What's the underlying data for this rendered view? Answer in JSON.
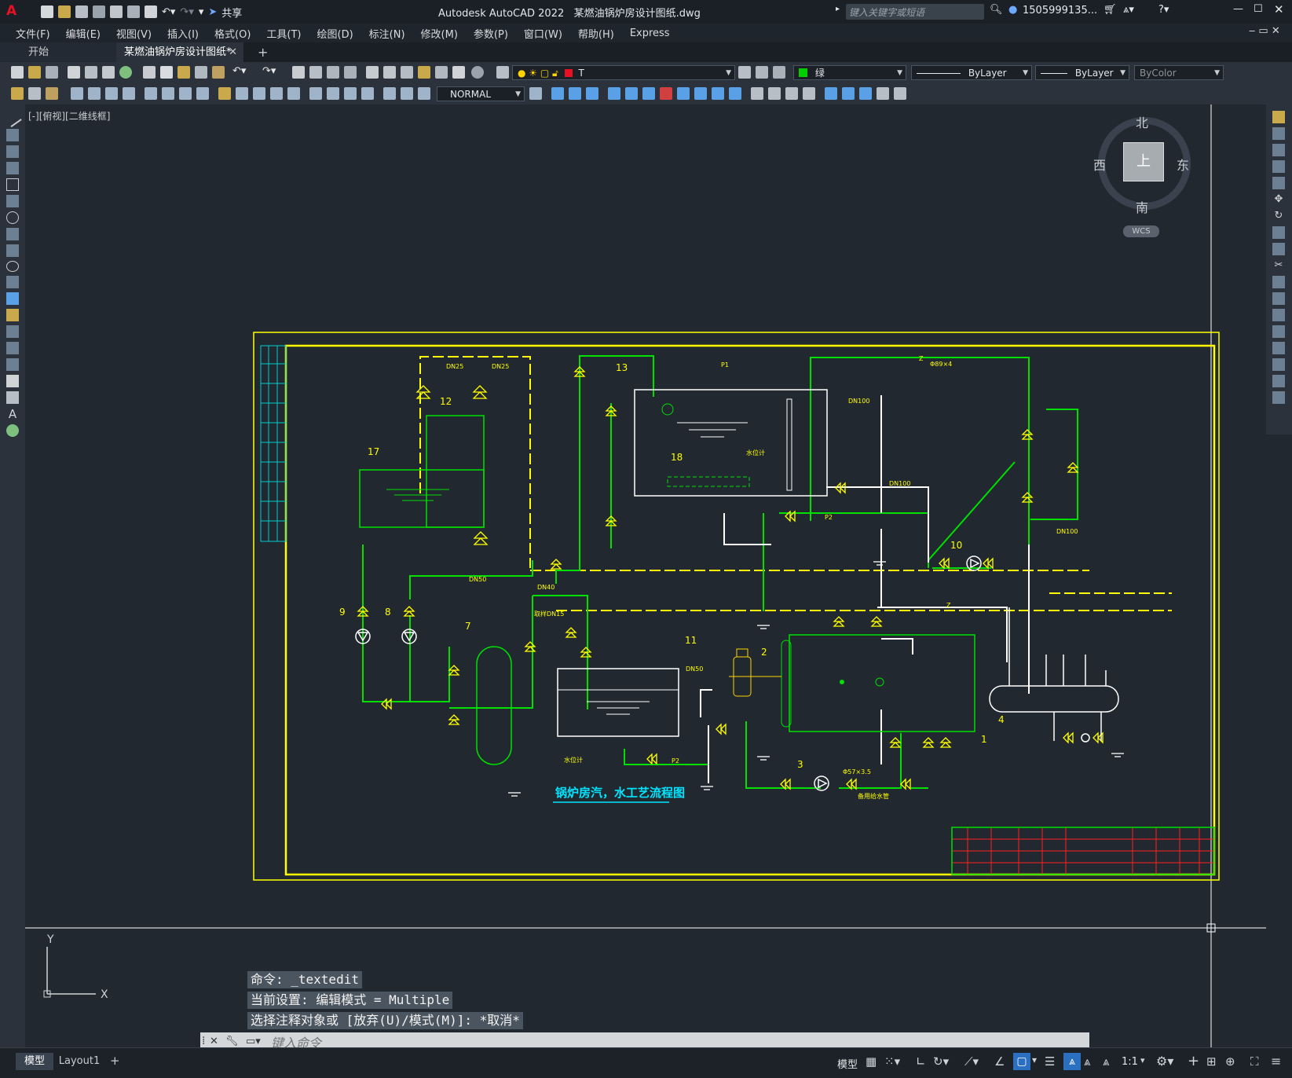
{
  "app": {
    "title": "Autodesk AutoCAD 2022",
    "file_name": "某燃油锅炉房设计图纸.dwg",
    "share_label": "共享",
    "search_placeholder": "键入关键字或短语",
    "user": "1505999135...",
    "app_letter": "A"
  },
  "menu": {
    "items": [
      "文件(F)",
      "编辑(E)",
      "视图(V)",
      "插入(I)",
      "格式(O)",
      "工具(T)",
      "绘图(D)",
      "标注(N)",
      "修改(M)",
      "参数(P)",
      "窗口(W)",
      "帮助(H)",
      "Express"
    ]
  },
  "tabs": {
    "start": "开始",
    "active": "某燃油锅炉房设计图纸*",
    "add": "+"
  },
  "properties": {
    "layer": "T",
    "color": "绿",
    "linetype": "ByLayer",
    "lineweight": "ByLayer",
    "plotstyle": "ByColor",
    "dimstyle": "NORMAL",
    "layer_color_hex": "#e81123",
    "current_color_hex": "#00d000"
  },
  "viewport": {
    "label": "[-][俯视][二维线框]"
  },
  "viewcube": {
    "north": "北",
    "south": "南",
    "east": "东",
    "west": "西",
    "top": "上",
    "wcs": "WCS"
  },
  "drawing": {
    "title": "锅炉房汽，水工艺流程图",
    "labels": {
      "n1": "1",
      "n2": "2",
      "n3": "3",
      "n4": "4",
      "n7": "7",
      "n8": "8",
      "n9": "9",
      "n10": "10",
      "n11": "11",
      "n12": "12",
      "n13": "13",
      "n17": "17",
      "n18": "18",
      "dn25a": "DN25",
      "dn25b": "DN25",
      "dn50a": "DN50",
      "dn50b": "DN50",
      "dn40": "DN40",
      "dn100a": "DN100",
      "dn100b": "DN100",
      "dn100c": "DN100",
      "z1": "Z",
      "z2": "Z",
      "p1a": "P1",
      "p2a": "P2",
      "p2b": "P2",
      "phi89": "Φ89×4",
      "phi57": "Φ57×3.5",
      "level": "水位计",
      "level2": "水位计",
      "pipe_spare": "备用给水管",
      "dn15": "取样DN15"
    }
  },
  "command": {
    "line1": "命令: _textedit",
    "line2": "当前设置: 编辑模式 = Multiple",
    "line3": "选择注释对象或 [放弃(U)/模式(M)]: *取消*",
    "placeholder": "键入命令"
  },
  "status": {
    "model_tab": "模型",
    "layout_tab": "Layout1",
    "model_label": "模型",
    "scale": "1:1"
  },
  "ucs": {
    "x": "X",
    "y": "Y"
  }
}
